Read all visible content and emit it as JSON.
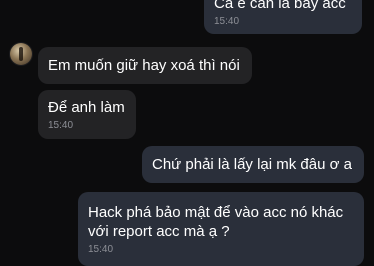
{
  "messages": [
    {
      "direction": "outgoing",
      "text": "Cả ế cần là bảy acc",
      "time": "15:40"
    },
    {
      "direction": "incoming",
      "text": "Em muốn giữ hay xoá thì nói",
      "time": ""
    },
    {
      "direction": "incoming",
      "text": "Để anh làm",
      "time": "15:40"
    },
    {
      "direction": "outgoing",
      "text": "Chứ phải là lấy lại mk đâu ơ a",
      "time": ""
    },
    {
      "direction": "outgoing",
      "text": "Hack phá bảo mật để vào acc nó khác\nvới report acc mà ạ ?",
      "time": "15:40"
    }
  ],
  "contact": {
    "avatar_icon": "contact-avatar"
  },
  "colors": {
    "background": "#0c0c0d",
    "incoming_bubble": "#232325",
    "outgoing_bubble": "#2a2f3a",
    "timestamp": "#8d8f96"
  }
}
